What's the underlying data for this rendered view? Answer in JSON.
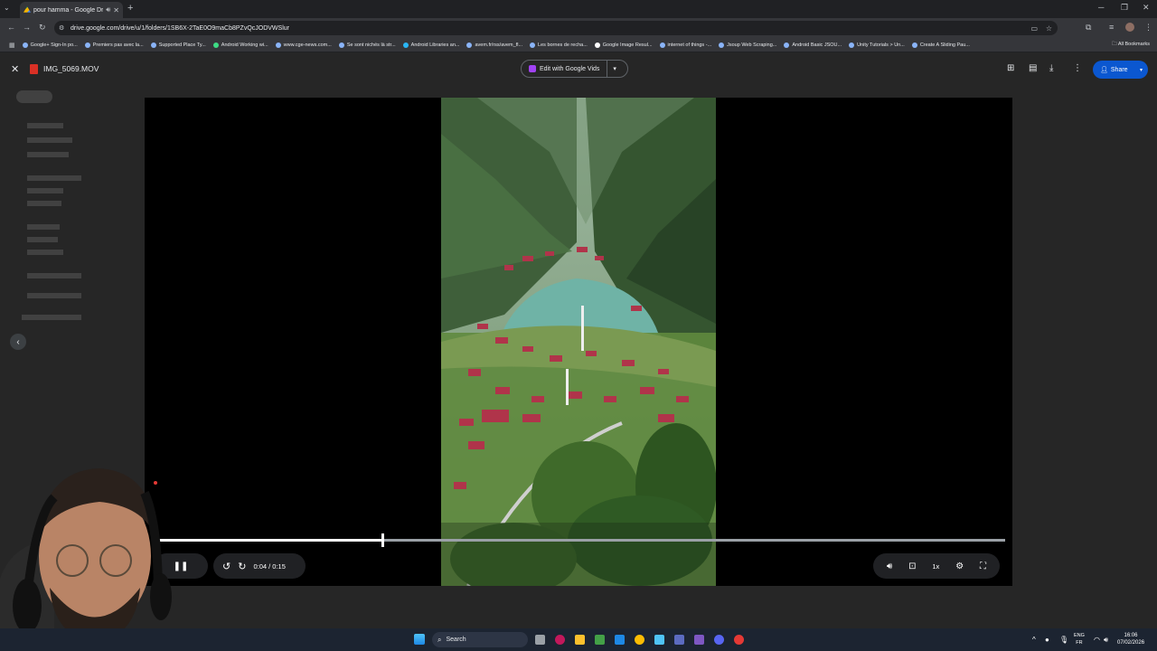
{
  "browser": {
    "tab_title": "pour hamma - Google Drive",
    "url": "drive.google.com/drive/u/1/folders/1SB6X-2TaE0O9maCb8PZvQcJODVWSlur",
    "bookmarks": [
      "Google+ Sign-In po...",
      "Premiers pas avec la...",
      "Supported Place Ty...",
      "Android Working wi...",
      "www.cge-news.com...",
      "Se sont nichés là str...",
      "Android Libraries an...",
      "avem.fr/rss/avem_fl...",
      "Les bornes de recha...",
      "Google Image Resul...",
      "internet of things -...",
      "Jsoup Web Scraping...",
      "Android Basic JSOU...",
      "Unity Tutorials > Un...",
      "Create A Sliding Pau..."
    ],
    "all_bookmarks": "All Bookmarks"
  },
  "viewer": {
    "file_name": "IMG_5069.MOV",
    "edit_button": "Edit with Google Vids",
    "share_button": "Share"
  },
  "player": {
    "time": "0:04 / 0:15",
    "progress": 0.267,
    "speed": "1x"
  },
  "taskbar": {
    "search_placeholder": "Search",
    "lang_top": "ENG",
    "lang_bottom": "FR",
    "time": "16:06",
    "date": "07/02/2026"
  },
  "colors": {
    "share_blue": "#0b57d0",
    "vids_purple": "#a142f4",
    "file_red": "#d93025"
  }
}
